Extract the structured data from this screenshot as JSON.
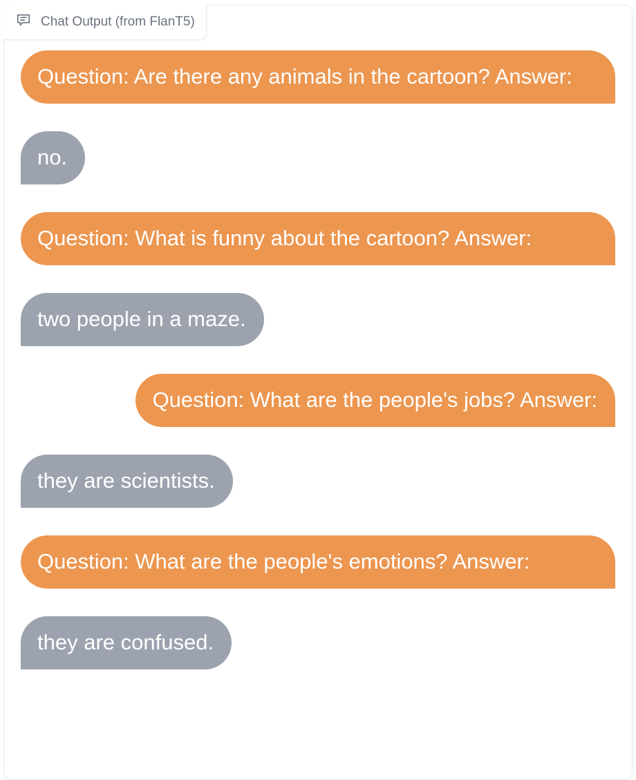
{
  "label": {
    "icon": "chat-icon",
    "text": "Chat Output (from FlanT5)"
  },
  "colors": {
    "user_bubble": "#ec9650",
    "bot_bubble": "#9ca3af"
  },
  "messages": [
    {
      "role": "user",
      "text": "Question: Are there any animals in the cartoon? Answer:"
    },
    {
      "role": "bot",
      "text": "no."
    },
    {
      "role": "user",
      "text": "Question: What is funny about the cartoon? Answer:"
    },
    {
      "role": "bot",
      "text": "two people in a maze."
    },
    {
      "role": "user",
      "text": "Question: What are the people's jobs? Answer:"
    },
    {
      "role": "bot",
      "text": "they are scientists."
    },
    {
      "role": "user",
      "text": "Question: What are the people's emotions? Answer:"
    },
    {
      "role": "bot",
      "text": "they are confused."
    }
  ]
}
